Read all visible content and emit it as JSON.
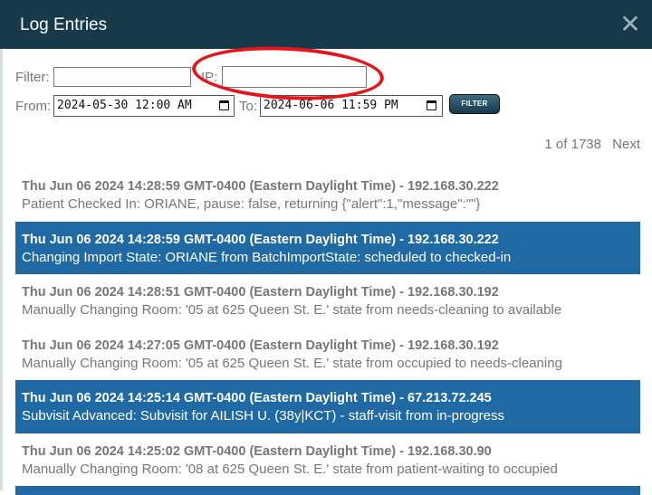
{
  "colors": {
    "titlebar": "#173a4b",
    "selected_row": "#1f6aa4",
    "annotation": "#e3141b",
    "muted_text": "#777777"
  },
  "dialog": {
    "title": "Log Entries",
    "close_icon": "close-icon"
  },
  "filters": {
    "filter_label": "Filter:",
    "filter_value": "",
    "ip_label": "IP:",
    "ip_value": "",
    "from_label": "From:",
    "from_value": "2024-05-30 12:00 AM",
    "to_label": "To:",
    "to_value": "2024-06-06 11:59 PM",
    "calendar_icon": "calendar-icon",
    "button_label": "FILTER"
  },
  "pagination": {
    "count": "1 of 1738",
    "next_label": "Next"
  },
  "entries": [
    {
      "header": "Thu Jun 06 2024 14:28:59 GMT-0400 (Eastern Daylight Time) - 192.168.30.222",
      "message": "Patient Checked In: ORIANE, pause: false, returning {\"alert\":1,\"message\":\"\"}",
      "selected": false
    },
    {
      "header": "Thu Jun 06 2024 14:28:59 GMT-0400 (Eastern Daylight Time) - 192.168.30.222",
      "message": "Changing Import State: ORIANE from BatchImportState: scheduled to checked-in",
      "selected": true
    },
    {
      "header": "Thu Jun 06 2024 14:28:51 GMT-0400 (Eastern Daylight Time) - 192.168.30.192",
      "message": "Manually Changing Room: '05 at 625 Queen St. E.' state from needs-cleaning to available",
      "selected": false
    },
    {
      "header": "Thu Jun 06 2024 14:27:05 GMT-0400 (Eastern Daylight Time) - 192.168.30.192",
      "message": "Manually Changing Room: '05 at 625 Queen St. E.' state from occupied to needs-cleaning",
      "selected": false
    },
    {
      "header": "Thu Jun 06 2024 14:25:14 GMT-0400 (Eastern Daylight Time) - 67.213.72.245",
      "message": "Subvisit Advanced: Subvisit for AILISH U. (38y|KCT) - staff-visit from in-progress",
      "selected": true
    },
    {
      "header": "Thu Jun 06 2024 14:25:02 GMT-0400 (Eastern Daylight Time) - 192.168.30.90",
      "message": "Manually Changing Room: '08 at 625 Queen St. E.' state from patient-waiting to occupied",
      "selected": false
    }
  ]
}
